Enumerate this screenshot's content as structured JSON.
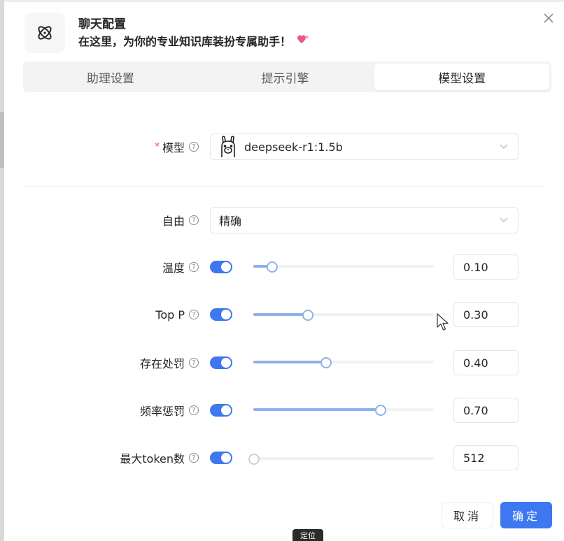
{
  "header": {
    "title": "聊天配置",
    "subtitle": "在这里，为你的专业知识库装扮专属助手！",
    "heart_icon": "heart-icon",
    "logo_icon": "atom-icon",
    "close_icon": "close-icon"
  },
  "tabs": [
    {
      "label": "助理设置",
      "active": false
    },
    {
      "label": "提示引擎",
      "active": false
    },
    {
      "label": "模型设置",
      "active": true
    }
  ],
  "model": {
    "label": "模型",
    "required": "*",
    "value": "deepseek-r1:1.5b",
    "icon": "llama-icon"
  },
  "freedom": {
    "label": "自由",
    "value": "精确"
  },
  "params": [
    {
      "label": "温度",
      "enabled": true,
      "fraction": 0.1,
      "value": "0.10"
    },
    {
      "label": "Top P",
      "enabled": true,
      "fraction": 0.3,
      "value": "0.30"
    },
    {
      "label": "存在处罚",
      "enabled": true,
      "fraction": 0.4,
      "value": "0.40"
    },
    {
      "label": "频率惩罚",
      "enabled": true,
      "fraction": 0.7,
      "value": "0.70"
    },
    {
      "label": "最大token数",
      "enabled": true,
      "fraction": 0.0,
      "value": "512"
    }
  ],
  "help_glyph": "?",
  "footer": {
    "cancel_label": "取消",
    "ok_label": "确定",
    "tooltip": "定位"
  },
  "colors": {
    "accent": "#3e78f0",
    "slider_track": "#8fb1ea",
    "required": "#e5484d"
  }
}
